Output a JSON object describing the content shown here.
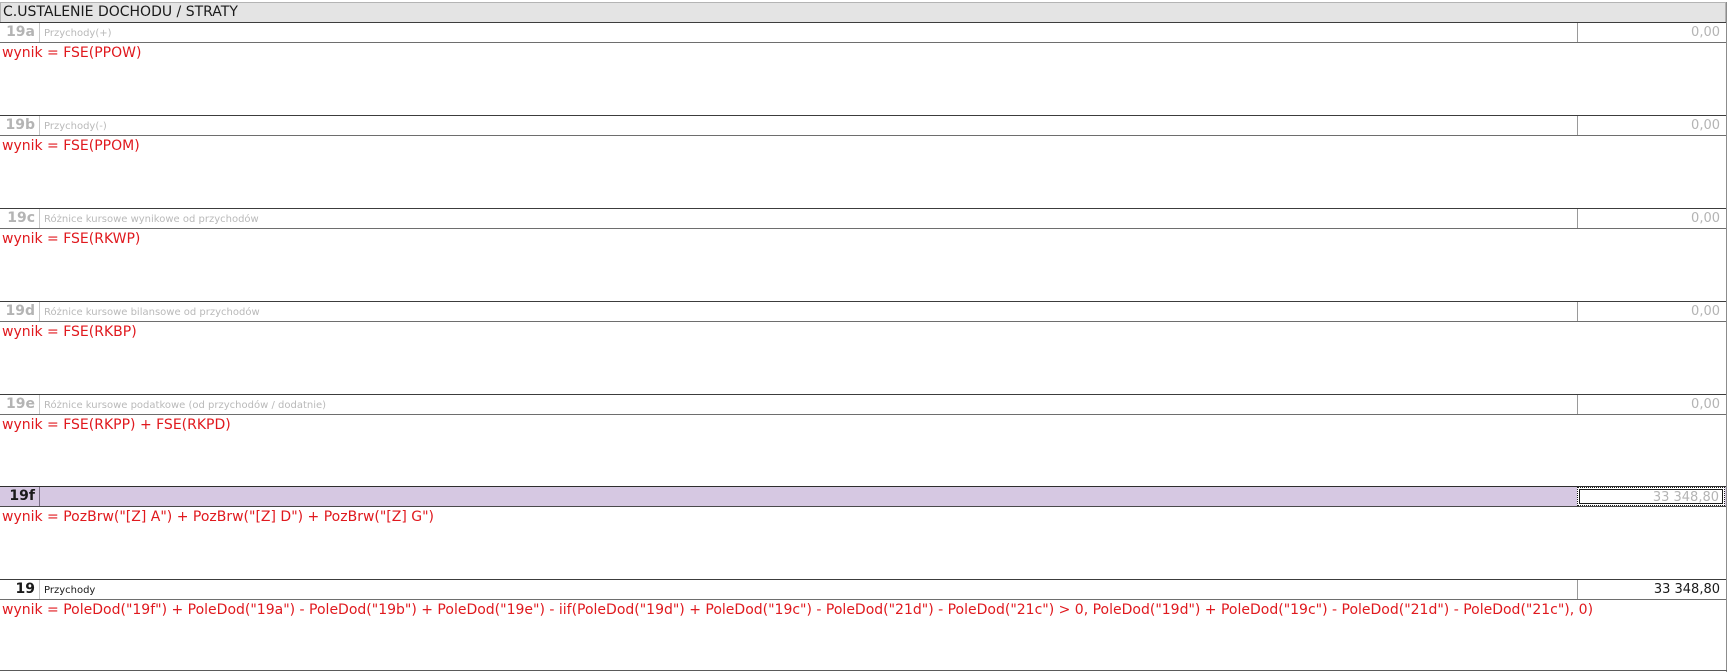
{
  "section": {
    "title": "C.USTALENIE DOCHODU / STRATY"
  },
  "fields": [
    {
      "code": "19a",
      "description": "Przychody(+)",
      "value": "0,00",
      "formula": "wynik = FSE(PPOW)"
    },
    {
      "code": "19b",
      "description": "Przychody(-)",
      "value": "0,00",
      "formula": "wynik = FSE(PPOM)"
    },
    {
      "code": "19c",
      "description": "Różnice kursowe wynikowe od przychodów",
      "value": "0,00",
      "formula": "wynik = FSE(RKWP)"
    },
    {
      "code": "19d",
      "description": "Różnice kursowe bilansowe od przychodów",
      "value": "0,00",
      "formula": "wynik = FSE(RKBP)"
    },
    {
      "code": "19e",
      "description": "Różnice kursowe podatkowe (od przychodów / dodatnie)",
      "value": "0,00",
      "formula": "wynik = FSE(RKPP) + FSE(RKPD)"
    },
    {
      "code": "19f",
      "description": "",
      "value": "33 348,80",
      "formula": "wynik = PozBrw(\"[Z] A\") + PozBrw(\"[Z] D\") + PozBrw(\"[Z] G\")"
    },
    {
      "code": "19",
      "description": "Przychody",
      "value": "33 348,80",
      "formula": "wynik = PoleDod(\"19f\") + PoleDod(\"19a\") - PoleDod(\"19b\") + PoleDod(\"19e\") - iif(PoleDod(\"19d\") + PoleDod(\"19c\") - PoleDod(\"21d\") - PoleDod(\"21c\") > 0, PoleDod(\"19d\") + PoleDod(\"19c\") - PoleDod(\"21d\") - PoleDod(\"21c\"), 0)"
    }
  ],
  "colors": {
    "formula_text": "#e0191e",
    "highlight_row": "#d6c8e2",
    "header_background": "#e4e4e4",
    "disabled_text": "#b4b4b4"
  }
}
